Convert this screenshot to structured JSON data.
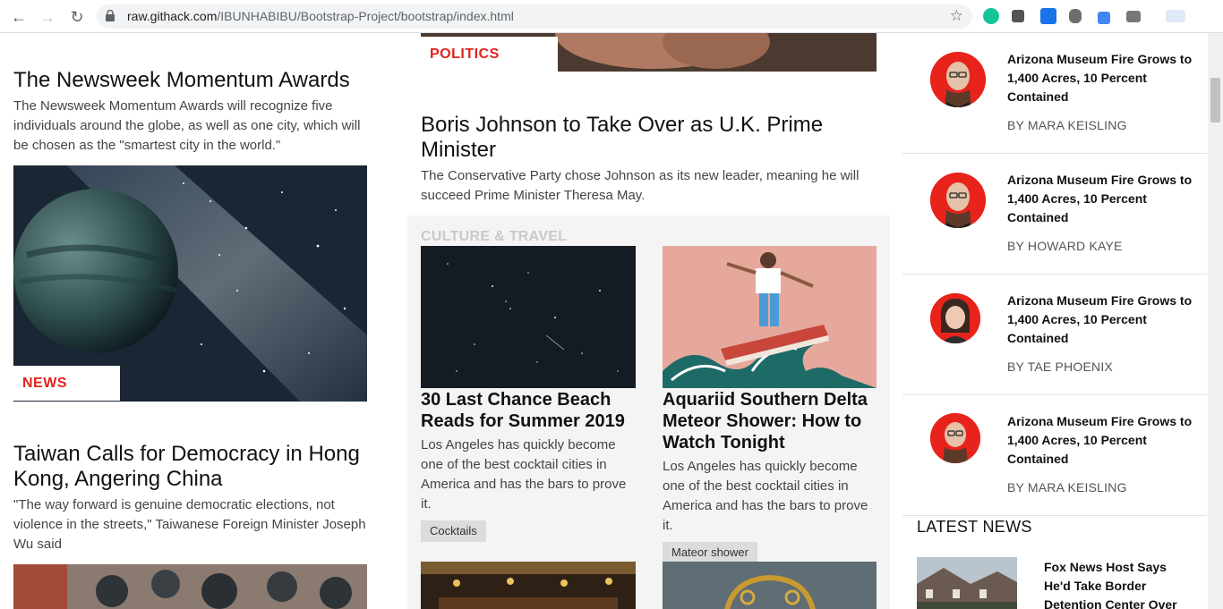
{
  "browser": {
    "url_host": "raw.githack.com",
    "url_path": "/IBUNHABIBU/Bootstrap-Project/bootstrap/index.html"
  },
  "left": {
    "story1": {
      "title": "The Newsweek Momentum Awards",
      "summary": "The Newsweek Momentum Awards will recognize five individuals around the globe, as well as one city, which will be chosen as the \"smartest city in the world.\"",
      "tag": "NEWS"
    },
    "story2": {
      "title": "Taiwan Calls for Democracy in Hong Kong, Angering China",
      "summary": "\"The way forward is genuine democratic elections, not violence in the streets,\" Taiwanese Foreign Minister Joseph Wu said"
    }
  },
  "middle": {
    "top_tag": "POLITICS",
    "story": {
      "title": "Boris Johnson to Take Over as U.K. Prime Minister",
      "summary": "The Conservative Party chose Johnson as its new leader, meaning he will succeed Prime Minister Theresa May."
    },
    "section_title": "CULTURE & TRAVEL",
    "cards": [
      {
        "title": "30 Last Chance Beach Reads for Summer 2019",
        "text": "Los Angeles has quickly become one of the best cocktail cities in America and has the bars to prove it.",
        "chip": "Cocktails"
      },
      {
        "title": "Aquariid Southern Delta Meteor Shower: How to Watch Tonight",
        "text": "Los Angeles has quickly become one of the best cocktail cities in America and has the bars to prove it.",
        "chip": "Mateor shower"
      }
    ]
  },
  "right": {
    "items": [
      {
        "title": "Arizona Museum Fire Grows to 1,400 Acres, 10 Percent Contained",
        "byline": "BY MARA KEISLING"
      },
      {
        "title": "Arizona Museum Fire Grows to 1,400 Acres, 10 Percent Contained",
        "byline": "BY HOWARD KAYE"
      },
      {
        "title": "Arizona Museum Fire Grows to 1,400 Acres, 10 Percent Contained",
        "byline": "BY TAE PHOENIX"
      },
      {
        "title": "Arizona Museum Fire Grows to 1,400 Acres, 10 Percent Contained",
        "byline": "BY MARA KEISLING"
      }
    ],
    "latest_heading": "LATEST NEWS",
    "latest_item_title": "Fox News Host Says He'd Take Border Detention Center Over"
  },
  "colors": {
    "accent_red": "#e0231d",
    "avatar_red": "#e8231c",
    "section_bg": "#f4f4f4"
  }
}
